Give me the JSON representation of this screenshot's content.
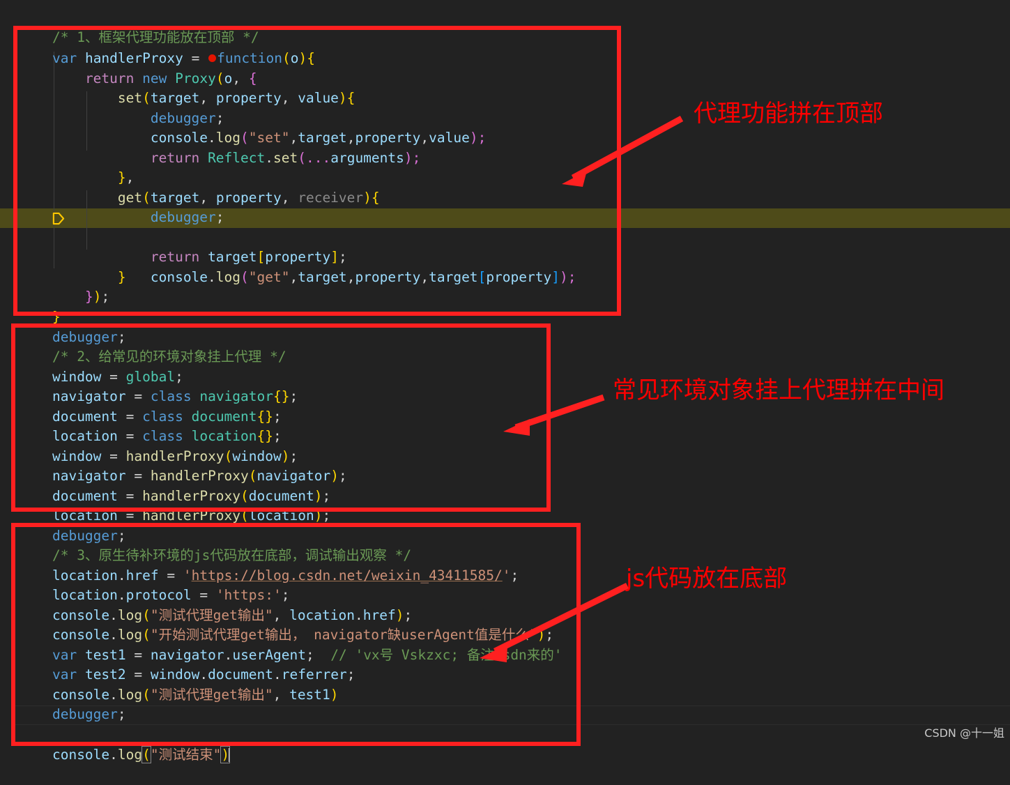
{
  "editor": {
    "background_color": "#222222",
    "highlight_line_color": "#4e4b19",
    "lines": [
      {
        "id": "l1",
        "text": "/* 1、框架代理功能放在顶部 */"
      },
      {
        "id": "l2",
        "text": "var handlerProxy = ●function(o){"
      },
      {
        "id": "l3",
        "text": "    return new Proxy(o, {"
      },
      {
        "id": "l4",
        "text": "        set(target, property, value){"
      },
      {
        "id": "l5",
        "text": "            debugger;"
      },
      {
        "id": "l6",
        "text": "            console.log(\"set\",target,property,value);"
      },
      {
        "id": "l7",
        "text": "            return Reflect.set(...arguments);"
      },
      {
        "id": "l8",
        "text": "        },"
      },
      {
        "id": "l9",
        "text": "        get(target, property, receiver){"
      },
      {
        "id": "l10",
        "text": "            debugger;"
      },
      {
        "id": "l11",
        "text": "            console.log(\"get\",target,property,target[property]);"
      },
      {
        "id": "l12",
        "text": "            return target[property];"
      },
      {
        "id": "l13",
        "text": "        }"
      },
      {
        "id": "l14",
        "text": "    });"
      },
      {
        "id": "l15",
        "text": "}"
      },
      {
        "id": "l16",
        "text": "debugger;"
      },
      {
        "id": "l17",
        "text": "/* 2、给常见的环境对象挂上代理 */"
      },
      {
        "id": "l18",
        "text": "window = global;"
      },
      {
        "id": "l19",
        "text": "navigator = class navigator{};"
      },
      {
        "id": "l20",
        "text": "document = class document{};"
      },
      {
        "id": "l21",
        "text": "location = class location{};"
      },
      {
        "id": "l22",
        "text": "window = handlerProxy(window);"
      },
      {
        "id": "l23",
        "text": "navigator = handlerProxy(navigator);"
      },
      {
        "id": "l24",
        "text": "document = handlerProxy(document);"
      },
      {
        "id": "l25",
        "text": "location = handlerProxy(location);"
      },
      {
        "id": "l26",
        "text": "debugger;"
      },
      {
        "id": "l27",
        "text": "/* 3、原生待补环境的js代码放在底部，调试输出观察 */"
      },
      {
        "id": "l28",
        "text": "location.href = 'https://blog.csdn.net/weixin_43411585/';"
      },
      {
        "id": "l29",
        "text": "location.protocol = 'https:';"
      },
      {
        "id": "l30",
        "text": "console.log(\"测试代理get输出\", location.href);"
      },
      {
        "id": "l31",
        "text": "console.log(\"开始测试代理get输出， navigator缺userAgent值是什么\");"
      },
      {
        "id": "l32",
        "text": "var test1 = navigator.userAgent;  // 'vx号 Vskzxc; 备注csdn来的'"
      },
      {
        "id": "l33",
        "text": "var test2 = window.document.referrer;"
      },
      {
        "id": "l34",
        "text": "console.log(\"测试代理get输出\", test1)"
      },
      {
        "id": "l35",
        "text": "debugger;"
      },
      {
        "id": "l36",
        "text": "console.log(\"测试结束\")"
      }
    ],
    "breakpoint_marker": "red-dot-breakpoint",
    "pause_marker": "debugger-pause-pentagon",
    "highlighted_line_id": "l11",
    "current_line_id": "l36"
  },
  "annotations": {
    "color": "#ff0000",
    "items": [
      {
        "id": "a1",
        "label": "代理功能拼在顶部"
      },
      {
        "id": "a2",
        "label": "常见环境对象挂上代理拼在中间"
      },
      {
        "id": "a3",
        "label": "js代码放在底部"
      }
    ],
    "boxes": [
      {
        "id": "box1",
        "target": "framework-proxy-block"
      },
      {
        "id": "box2",
        "target": "env-objects-block"
      },
      {
        "id": "box3",
        "target": "native-js-block"
      }
    ]
  },
  "watermark": {
    "text": "CSDN @十一姐"
  }
}
